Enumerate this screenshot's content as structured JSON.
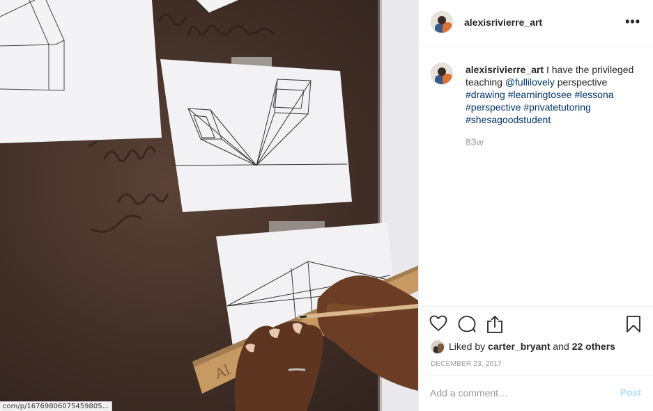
{
  "post": {
    "username": "alexisrivierre_art",
    "more_icon": "more-horizontal-icon",
    "caption": {
      "username": "alexisrivierre_art",
      "text_1": " I have the privileged teaching ",
      "mention": "@fullilovely",
      "text_2": " perspective ",
      "hashtags": [
        "#drawing",
        "#learningtosee",
        "#lessona",
        "#perspective",
        "#privatetutoring",
        "#shesagoodstudent"
      ],
      "time": "83w"
    },
    "actions": {
      "like_icon": "heart-icon",
      "comment_icon": "comment-icon",
      "share_icon": "share-icon",
      "save_icon": "bookmark-icon"
    },
    "likes": {
      "prefix": "Liked by ",
      "user": "carter_bryant",
      "middle": " and ",
      "others": "22 others"
    },
    "date": "DECEMBER 23, 2017",
    "comment": {
      "placeholder": "Add a comment…",
      "post_label": "Post"
    }
  },
  "status_url": "com/p/16769806075459805..."
}
